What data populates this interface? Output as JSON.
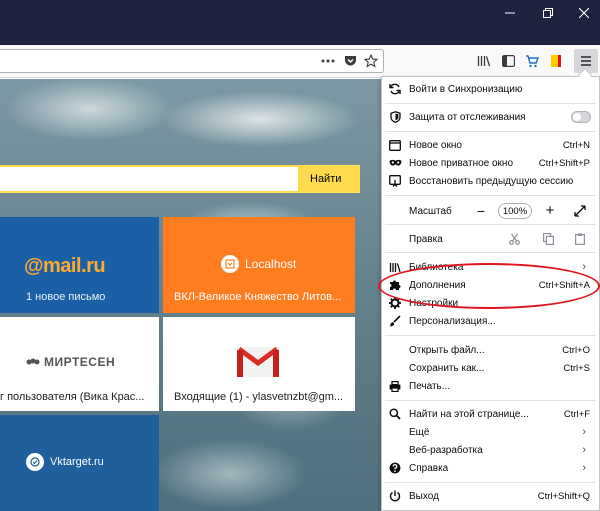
{
  "window": {
    "minimize_icon": "minimize-icon",
    "restore_icon": "restore-icon",
    "close_icon": "close-icon"
  },
  "navbar": {
    "url_value": "",
    "icons": [
      "page-actions-icon",
      "pocket-icon",
      "bookmark-star-icon",
      "library-icon",
      "sidebar-icon",
      "cart-icon",
      "yandex-bookmark-icon",
      "hamburger-menu-icon"
    ]
  },
  "page": {
    "search": {
      "value": "",
      "button_label": "Найти"
    },
    "tiles": {
      "mail": {
        "logo": "@mail.ru",
        "caption": "1 новое письмо",
        "bg": "#1b5fa6"
      },
      "localhost": {
        "title": "Localhost",
        "caption": "ВКЛ-Великое Княжество Литов...",
        "bg": "#ff7c1f"
      },
      "mirtesen": {
        "logo": "МИРТЕСЕН",
        "caption": "г пользователя (Вика Крас..."
      },
      "gmail": {
        "caption": "Входящие (1) - ylasvetnzbt@gm..."
      },
      "vktarget": {
        "title": "Vktarget.ru",
        "bg": "#1f5f9c"
      }
    }
  },
  "menu": {
    "sync": "Войти в Синхронизацию",
    "tracking": "Защита от отслеживания",
    "tracking_enabled": false,
    "new_window": {
      "label": "Новое окно",
      "shortcut": "Ctrl+N"
    },
    "private_window": {
      "label": "Новое приватное окно",
      "shortcut": "Ctrl+Shift+P"
    },
    "restore_session": "Восстановить предыдущую сессию",
    "zoom": {
      "label": "Масштаб",
      "minus": "−",
      "value": "100%",
      "plus": "+"
    },
    "edit": "Правка",
    "library": "Библиотека",
    "addons": {
      "label": "Дополнения",
      "shortcut": "Ctrl+Shift+A"
    },
    "settings": "Настройки",
    "customize": "Персонализация...",
    "open_file": {
      "label": "Открыть файл...",
      "shortcut": "Ctrl+O"
    },
    "save_as": {
      "label": "Сохранить как...",
      "shortcut": "Ctrl+S"
    },
    "print": "Печать...",
    "find": {
      "label": "Найти на этой странице...",
      "shortcut": "Ctrl+F"
    },
    "more": "Ещё",
    "webdev": "Веб-разработка",
    "help": "Справка",
    "quit": {
      "label": "Выход",
      "shortcut": "Ctrl+Shift+Q"
    },
    "chevron": "›"
  },
  "colors": {
    "titlebar": "#202340",
    "search_accent": "#ffdb4d",
    "annotation": "#e0141e",
    "gmail_red": "#d93025"
  }
}
